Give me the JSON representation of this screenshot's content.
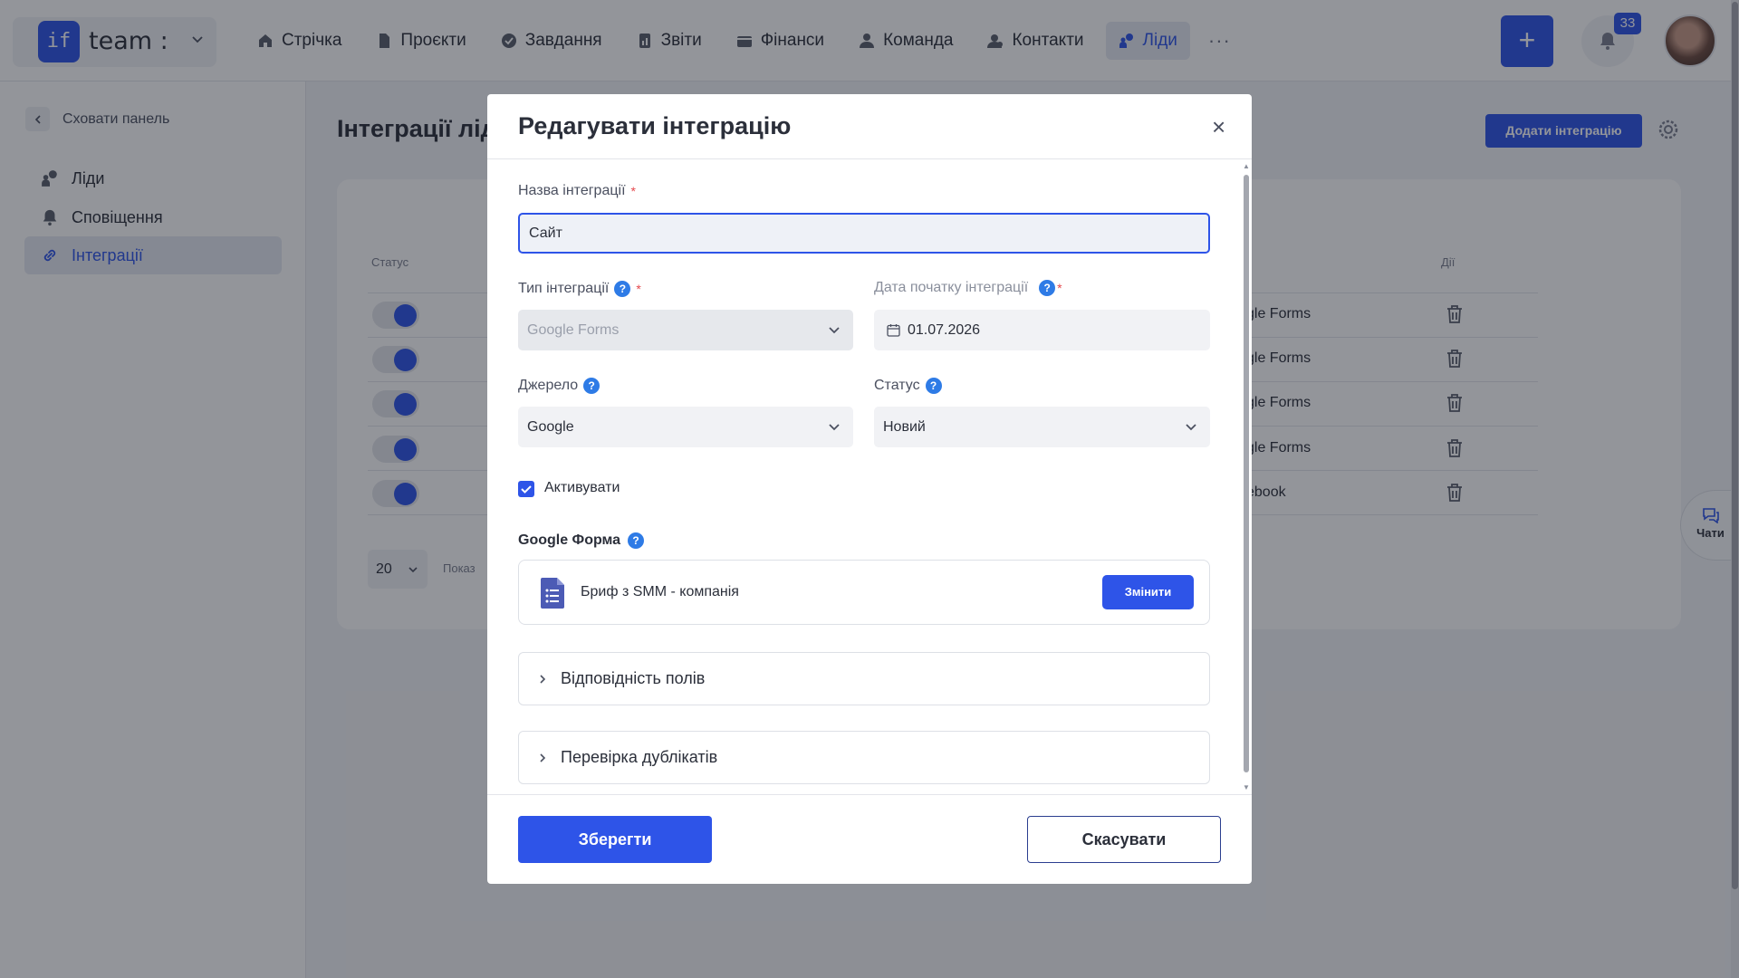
{
  "header": {
    "logo_text": "if",
    "workspace": "team :",
    "nav": [
      {
        "label": "Стрічка",
        "icon": "home-icon"
      },
      {
        "label": "Проєкти",
        "icon": "file-icon"
      },
      {
        "label": "Завдання",
        "icon": "check-circle-icon"
      },
      {
        "label": "Звіти",
        "icon": "report-icon"
      },
      {
        "label": "Фінанси",
        "icon": "wallet-icon"
      },
      {
        "label": "Команда",
        "icon": "user-icon"
      },
      {
        "label": "Контакти",
        "icon": "contacts-icon"
      },
      {
        "label": "Ліди",
        "icon": "leads-icon",
        "active": true
      }
    ],
    "more": "···",
    "create": "+",
    "notifications_count": "33"
  },
  "sidebar": {
    "hide_label": "Сховати панель",
    "items": [
      {
        "label": "Ліди",
        "icon": "leads-icon"
      },
      {
        "label": "Сповіщення",
        "icon": "bell-icon"
      },
      {
        "label": "Інтеграції",
        "icon": "link-icon",
        "active": true
      }
    ]
  },
  "page": {
    "title": "Інтеграції лід",
    "add_button": "Додати інтеграцію",
    "table": {
      "col_status": "Статус",
      "col_actions": "Дії",
      "rows": [
        {
          "type": "gle Forms"
        },
        {
          "type": "gle Forms"
        },
        {
          "type": "gle Forms"
        },
        {
          "type": "gle Forms"
        },
        {
          "type": "ebook"
        }
      ]
    },
    "per_page": "20",
    "showing": "Показ"
  },
  "chats_label": "Чати",
  "modal": {
    "title": "Редагувати інтеграцію",
    "close": "×",
    "name_label": "Назва інтеграції",
    "name_value": "Сайт",
    "type_label": "Тип інтеграції",
    "type_value": "Google Forms",
    "date_label": "Дата початку інтеграції",
    "date_value": "01.07.2026",
    "source_label": "Джерело",
    "source_value": "Google",
    "status_label": "Статус",
    "status_value": "Новий",
    "activate_label": "Активувати",
    "activate_checked": true,
    "gform_label": "Google Форма",
    "gform_name": "Бриф з SMM - компанія",
    "change_button": "Змінити",
    "section_fields": "Відповідність полів",
    "section_duplicates": "Перевірка дублікатів",
    "save_button": "Зберегти",
    "cancel_button": "Скасувати",
    "required_mark": "*",
    "help_mark": "?"
  },
  "colors": {
    "accent": "#2e54e8",
    "help": "#2e7be6",
    "required": "#e5484d",
    "overlay": "rgba(20,24,34,0.46)"
  }
}
